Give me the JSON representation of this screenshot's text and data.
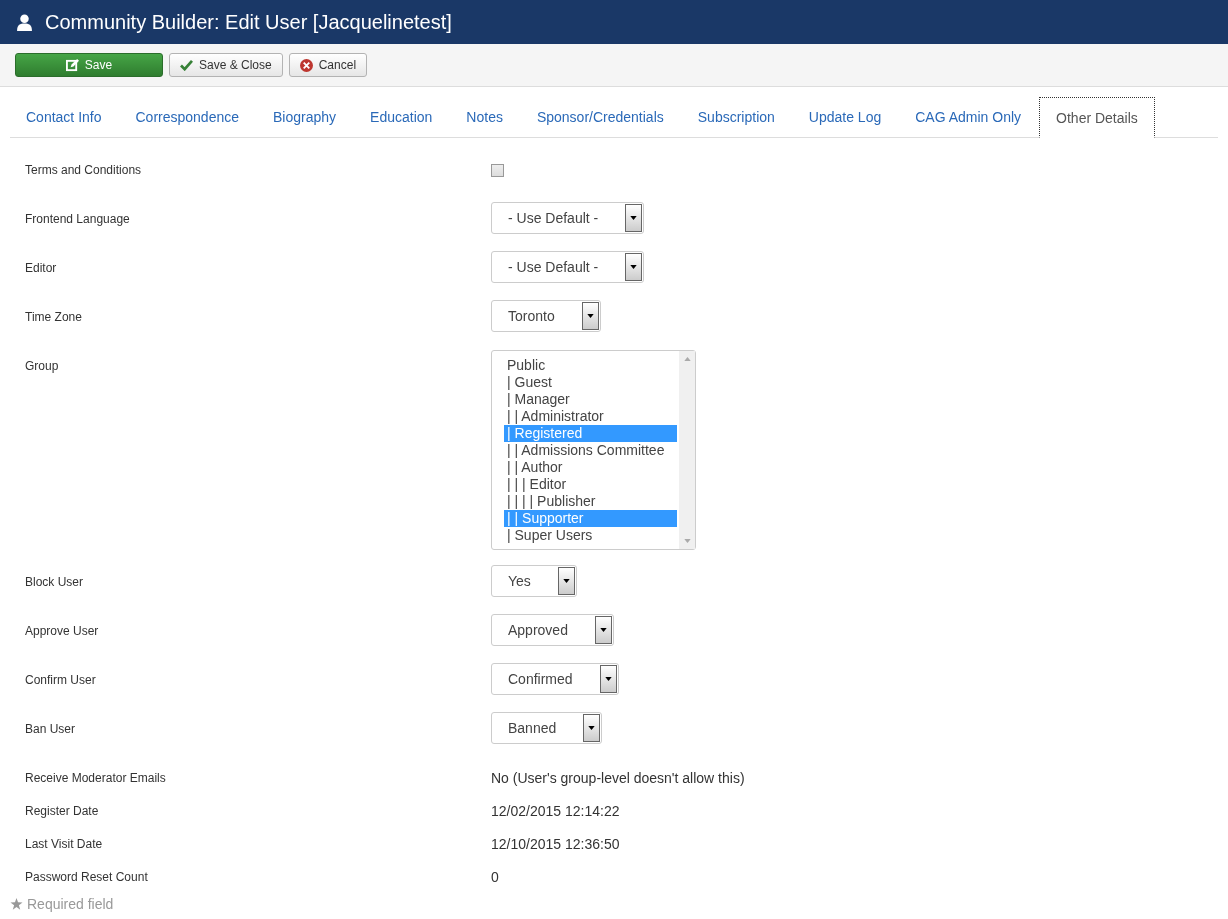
{
  "window": {
    "title": "Community Builder: Edit User [Jacquelinetest]"
  },
  "toolbar": [
    {
      "kind": "save",
      "label": "Save"
    },
    {
      "kind": "save_close",
      "label": "Save & Close"
    },
    {
      "kind": "cancel",
      "label": "Cancel"
    }
  ],
  "tabs": [
    {
      "label": "Contact Info",
      "selected": false
    },
    {
      "label": "Correspondence",
      "selected": false
    },
    {
      "label": "Biography",
      "selected": false
    },
    {
      "label": "Education",
      "selected": false
    },
    {
      "label": "Notes",
      "selected": false
    },
    {
      "label": "Sponsor/Credentials",
      "selected": false
    },
    {
      "label": "Subscription",
      "selected": false
    },
    {
      "label": "Update Log",
      "selected": false
    },
    {
      "label": "CAG Admin Only",
      "selected": false
    },
    {
      "label": "Other Details",
      "selected": true
    }
  ],
  "fields": [
    {
      "kind": "checkbox",
      "label": "Terms and Conditions",
      "checked": false
    },
    {
      "kind": "select",
      "label": "Frontend Language",
      "value": "- Use Default -"
    },
    {
      "kind": "select",
      "label": "Editor",
      "value": "- Use Default -"
    },
    {
      "kind": "select",
      "label": "Time Zone",
      "value": "Toronto"
    },
    {
      "kind": "listbox",
      "label": "Group",
      "options": [
        {
          "label": "Public",
          "selected": false
        },
        {
          "label": "| Guest",
          "selected": false
        },
        {
          "label": "| Manager",
          "selected": false
        },
        {
          "label": "| | Administrator",
          "selected": false
        },
        {
          "label": "| Registered",
          "selected": true
        },
        {
          "label": "| | Admissions Committee",
          "selected": false
        },
        {
          "label": "| | Author",
          "selected": false
        },
        {
          "label": "| | | Editor",
          "selected": false
        },
        {
          "label": "| | | | Publisher",
          "selected": false
        },
        {
          "label": "| | Supporter",
          "selected": true
        },
        {
          "label": "| Super Users",
          "selected": false
        }
      ]
    },
    {
      "kind": "select",
      "label": "Block User",
      "value": "Yes"
    },
    {
      "kind": "select",
      "label": "Approve User",
      "value": "Approved"
    },
    {
      "kind": "select",
      "label": "Confirm User",
      "value": "Confirmed"
    },
    {
      "kind": "select",
      "label": "Ban User",
      "value": "Banned"
    },
    {
      "kind": "text",
      "label": "Receive Moderator Emails",
      "value": "No (User's group-level doesn't allow this)"
    },
    {
      "kind": "text",
      "label": "Register Date",
      "value": "12/02/2015 12:14:22"
    },
    {
      "kind": "text",
      "label": "Last Visit Date",
      "value": "12/10/2015 12:36:50"
    },
    {
      "kind": "text",
      "label": "Password Reset Count",
      "value": "0"
    }
  ],
  "footnote": "Required field"
}
